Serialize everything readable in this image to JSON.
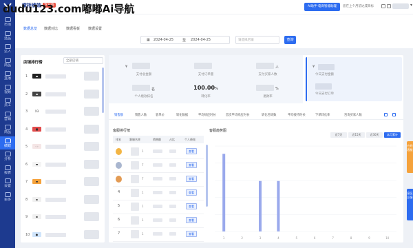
{
  "watermark": "dudu123.com嘟嘟Ai导航",
  "app": {
    "brand": "掌柜绩效",
    "brand_badge": "专业版",
    "accent": "#2d6cf0",
    "sidebar_color": "#1d3a8f"
  },
  "sidebar": {
    "items": [
      {
        "label": "市场"
      },
      {
        "label": "选品"
      },
      {
        "label": "达人"
      },
      {
        "label": "商品"
      },
      {
        "label": "直播"
      },
      {
        "label": "视频"
      },
      {
        "label": "员工"
      },
      {
        "label": "营销"
      },
      {
        "label": "商品"
      },
      {
        "label": "绩效",
        "active": true
      },
      {
        "label": "分析"
      },
      {
        "label": "报表"
      },
      {
        "label": "设置"
      },
      {
        "label": "更多"
      }
    ]
  },
  "topbar": {
    "primary_button": "AI助手-电商智能助理",
    "note": "您在上个月前达成目标",
    "user_chevron": "▾"
  },
  "tabs": [
    {
      "label": "数据总览",
      "active": true
    },
    {
      "label": "数据对比"
    },
    {
      "label": "数据看板"
    },
    {
      "label": "数据设置"
    }
  ],
  "filters": {
    "date_start": "2024-04-25",
    "date_end": "2024-04-25",
    "date_sep": "至",
    "select_placeholder": "请选择店铺",
    "query_button": "查询"
  },
  "shop_ranking": {
    "title": "店铺排行榜",
    "select_value": "全部店铺",
    "rows": [
      {
        "rank": "1",
        "logo_text": "▬",
        "logo_color": "#222"
      },
      {
        "rank": "2",
        "logo_text": "▬",
        "logo_color": "#444"
      },
      {
        "rank": "3",
        "logo_text": "X3",
        "logo_color": "#fff"
      },
      {
        "rank": "4",
        "logo_text": "■",
        "logo_color": "#e24b4b"
      },
      {
        "rank": "5",
        "logo_text": "◦◦",
        "logo_color": "#f5e6e6"
      },
      {
        "rank": "6",
        "logo_text": "▬",
        "logo_color": "#f4f4f4"
      },
      {
        "rank": "7",
        "logo_text": "▬",
        "logo_color": "#f5a23b"
      },
      {
        "rank": "8",
        "logo_text": "▪",
        "logo_color": "#f0f0f0"
      },
      {
        "rank": "9",
        "logo_text": "▪",
        "logo_color": "#f0f0f0"
      },
      {
        "rank": "10",
        "logo_text": "●",
        "logo_color": "#cfe4fb"
      }
    ]
  },
  "stats": [
    {
      "label": "支付总金额",
      "unit": "¥",
      "masked": true
    },
    {
      "label": "支付订单量",
      "unit": "",
      "masked": true
    },
    {
      "label": "支付买家人数",
      "unit": "人",
      "masked": true
    },
    {
      "label": "个人绩效排名",
      "unit": "名",
      "masked": true
    },
    {
      "label": "转化率",
      "value": "100.00",
      "unit": "%"
    },
    {
      "label": "退款率",
      "unit": "%",
      "masked": true
    }
  ],
  "side_stats": [
    {
      "label": "今日支付金额",
      "unit": "¥"
    },
    {
      "label": "今日支付订单",
      "unit": ""
    }
  ],
  "metric_tabs": [
    {
      "label": "销售额",
      "active": true
    },
    {
      "label": "销售人数"
    },
    {
      "label": "客单价"
    },
    {
      "label": "转化数据"
    },
    {
      "label": "平均响应时长"
    },
    {
      "label": "首次平均响应时长"
    },
    {
      "label": "转化咨询数"
    },
    {
      "label": "平均接待时长"
    },
    {
      "label": "下单转化率"
    },
    {
      "label": "咨询买家人数"
    }
  ],
  "product_ranking": {
    "title": "客服排行榜",
    "headers": [
      "排名",
      "客服名称",
      "销售额",
      "占比",
      "个人绩效"
    ],
    "view_label": "查看",
    "rows": [
      {
        "rank": "1",
        "medal": "gold",
        "tag": "1"
      },
      {
        "rank": "2",
        "medal": "silver",
        "tag": "7"
      },
      {
        "rank": "3",
        "medal": "bronze",
        "tag": "7"
      },
      {
        "rank": "4",
        "tag": "1"
      },
      {
        "rank": "5",
        "tag": "1"
      },
      {
        "rank": "6",
        "tag": "1"
      },
      {
        "rank": "7",
        "tag": "1"
      }
    ]
  },
  "trend": {
    "title": "客服趋势图",
    "toggles": [
      {
        "label": "近7天"
      },
      {
        "label": "近15天"
      },
      {
        "label": "近30天"
      },
      {
        "label": "本月累计",
        "active": true
      }
    ]
  },
  "chart_data": {
    "type": "bar",
    "categories": [
      "1",
      "2",
      "3",
      "4",
      "5",
      "6",
      "7",
      "8",
      "9",
      "10"
    ],
    "values": [
      100,
      0,
      65,
      65,
      0,
      0,
      0,
      0,
      0,
      0
    ],
    "ylim": [
      0,
      110
    ],
    "grid": true,
    "color": "#9aa9ec"
  },
  "float_tabs": [
    {
      "label": "在线客服",
      "color": "#f5a23b"
    },
    {
      "label": "意见反馈",
      "color": "#2d6cf0"
    }
  ]
}
